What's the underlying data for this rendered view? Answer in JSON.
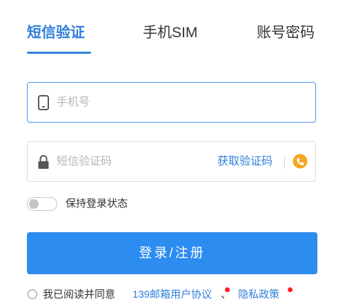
{
  "tabs": [
    {
      "label": "短信验证",
      "active": true
    },
    {
      "label": "手机SIM",
      "active": false
    },
    {
      "label": "账号密码",
      "active": false
    }
  ],
  "phone": {
    "placeholder": "手机号",
    "value": "",
    "icon": "phone-icon"
  },
  "sms": {
    "placeholder": "短信验证码",
    "value": "",
    "icon": "lock-icon",
    "get_code_label": "获取验证码",
    "voice_icon": "voice-code-icon"
  },
  "keep_login": {
    "label": "保持登录状态",
    "enabled": false
  },
  "login_button": {
    "label": "登录/注册"
  },
  "agreement": {
    "prefix": "我已阅读并同意",
    "link1": "139邮箱用户协议",
    "separator": "、",
    "link2": "隐私政策",
    "checked": false
  },
  "colors": {
    "accent": "#2f7fdb",
    "button": "#2d8cf0",
    "focus_border": "#4a90e2",
    "voice_icon": "#f5a623",
    "dot": "#ff1e1e"
  }
}
